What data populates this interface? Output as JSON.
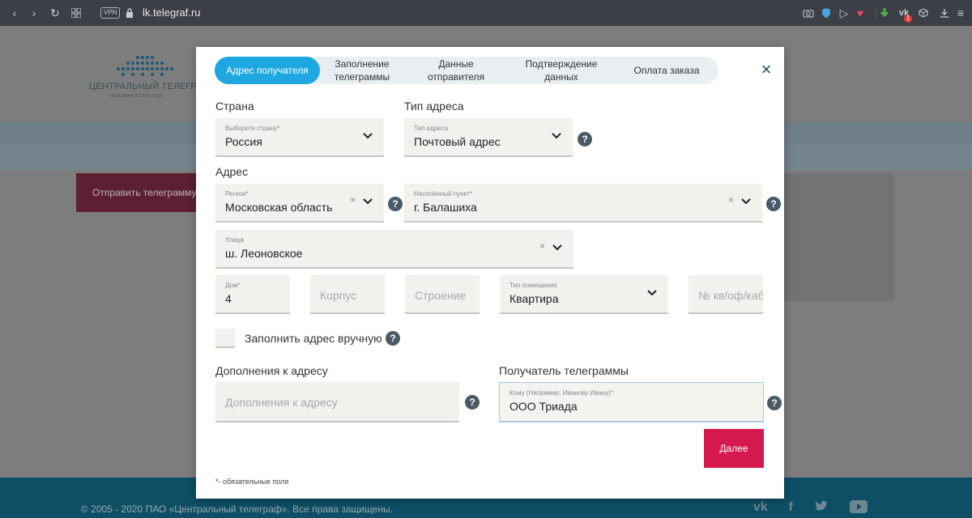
{
  "browser": {
    "url": "lk.telegraf.ru",
    "vpn": "VPN",
    "vk_badge": "1"
  },
  "background_page": {
    "logo_title": "ЦЕНТРАЛЬНЫЙ ТЕЛЕГРАФ",
    "logo_subtitle": "ОСНОВАН В 1957 ГОДУ",
    "send_button": "Отправить телеграмму",
    "footer_text": "© 2005 - 2020 ПАО «Центральный телеграф». Все права защищены."
  },
  "modal": {
    "steps": [
      {
        "label": "Адрес получателя",
        "active": true
      },
      {
        "label": "Заполнение телеграммы",
        "active": false
      },
      {
        "label": "Данные отправителя",
        "active": false
      },
      {
        "label": "Подтверждение данных",
        "active": false
      },
      {
        "label": "Оплата заказа",
        "active": false
      }
    ],
    "close_icon": "×",
    "country": {
      "section_label": "Страна",
      "caption": "Выберите страну*",
      "value": "Россия"
    },
    "address_type": {
      "section_label": "Тип адреса",
      "caption": "Тип адреса",
      "value": "Почтовый адрес"
    },
    "address_section_label": "Адрес",
    "region": {
      "caption": "Регион*",
      "value": "Московская область"
    },
    "locality": {
      "caption": "Населённый пункт*",
      "value": "г. Балашиха"
    },
    "street": {
      "caption": "Улица",
      "value": "ш. Леоновское"
    },
    "house": {
      "caption": "Дом*",
      "value": "4"
    },
    "building": {
      "placeholder": "Корпус"
    },
    "structure": {
      "placeholder": "Строение"
    },
    "room_type": {
      "caption": "Тип помещения",
      "value": "Квартира"
    },
    "apartment": {
      "placeholder": "№ кв/оф/каб"
    },
    "manual_fill": {
      "label": "Заполнить адрес вручную",
      "checked": false
    },
    "address_additions": {
      "section_label": "Дополнения к адресу",
      "placeholder": "Дополнения к адресу"
    },
    "recipient": {
      "section_label": "Получатель телеграммы",
      "caption": "Кому (Например, Иванову Ивану)*",
      "value": "ООО Триада"
    },
    "next_button": "Далее",
    "required_note": "*- обязательные поля",
    "help_glyph": "?",
    "clear_glyph": "×"
  },
  "colors": {
    "accent_blue": "#1ea7e1",
    "submit_pink": "#d5194f",
    "field_bg": "#f2f1ee"
  }
}
